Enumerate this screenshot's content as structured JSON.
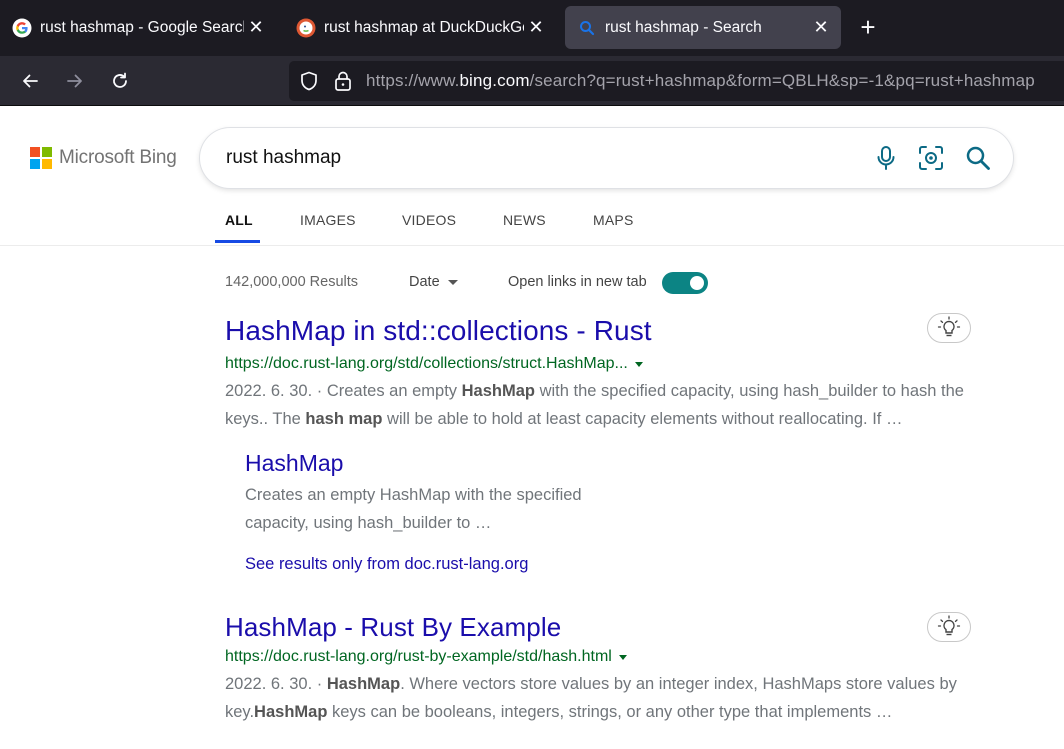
{
  "browser": {
    "tabs": [
      {
        "title": "rust hashmap - Google Search",
        "favicon": "google-icon",
        "active": false
      },
      {
        "title": "rust hashmap at DuckDuckGo",
        "favicon": "duckduckgo-icon",
        "active": false
      },
      {
        "title": "rust hashmap - Search",
        "favicon": "bing-search-icon",
        "active": true
      }
    ],
    "close_glyph": "✕",
    "new_tab_glyph": "+",
    "url": {
      "prefix": "https://www.",
      "host": "bing.com",
      "path": "/search?q=rust+hashmap&form=QBLH&sp=-1&pq=rust+hashmap"
    }
  },
  "bing": {
    "brand": "Microsoft Bing",
    "search_value": "rust hashmap",
    "scopes": [
      {
        "label": "ALL",
        "active": true
      },
      {
        "label": "IMAGES",
        "active": false
      },
      {
        "label": "VIDEOS",
        "active": false
      },
      {
        "label": "NEWS",
        "active": false
      },
      {
        "label": "MAPS",
        "active": false
      }
    ],
    "results_count": "142,000,000 Results",
    "date_filter": "Date",
    "new_tab_label": "Open links in new tab",
    "new_tab_enabled": true
  },
  "results": [
    {
      "title": "HashMap in std::collections - Rust",
      "url": "https://doc.rust-lang.org/std/collections/struct.HashMap...",
      "date": "2022. 6. 30. · ",
      "snippet_parts": [
        {
          "t": "Creates an empty ",
          "b": false
        },
        {
          "t": "HashMap",
          "b": true
        },
        {
          "t": " with the specified capacity, using hash_builder to hash the keys.. The ",
          "b": false
        },
        {
          "t": "hash map",
          "b": true
        },
        {
          "t": " will be able to hold at least capacity elements without reallocating. If …",
          "b": false
        }
      ],
      "deep_link": {
        "title": "HashMap",
        "snippet": "Creates an empty HashMap with the specified capacity, using hash_builder to …"
      },
      "see_more": "See results only from doc.rust-lang.org"
    },
    {
      "title": "HashMap - Rust By Example",
      "url": "https://doc.rust-lang.org/rust-by-example/std/hash.html",
      "date": "2022. 6. 30. · ",
      "snippet_parts": [
        {
          "t": "HashMap",
          "b": true
        },
        {
          "t": ". Where vectors store values by an integer index, HashMaps store values by key.",
          "b": false
        },
        {
          "t": "HashMap",
          "b": true
        },
        {
          "t": " keys can be booleans, integers, strings, or any other type that implements …",
          "b": false
        }
      ]
    }
  ],
  "colors": {
    "tab_bar_bg": "#1c1b22",
    "nav_bar_bg": "#2b2a33",
    "active_tab_bg": "#42414d",
    "link_blue": "#1a0dab",
    "url_green": "#006621",
    "scope_underline": "#174ae4",
    "toggle_on": "#0c8484",
    "ms_red": "#f25022",
    "ms_green": "#7fba00",
    "ms_blue": "#00a4ef",
    "ms_yellow": "#ffb900"
  }
}
